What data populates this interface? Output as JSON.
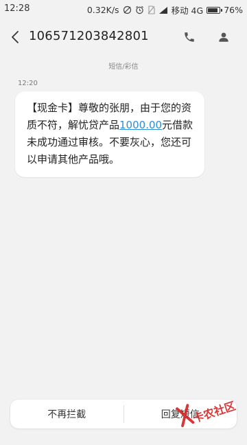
{
  "status_bar": {
    "time": "12:28",
    "speed": "0.32K/s",
    "carrier": "移动 4G",
    "battery": "76%",
    "battery_level": 0.76
  },
  "header": {
    "sender": "106571203842801"
  },
  "thread": {
    "label": "短信/彩信",
    "message_time": "12:20",
    "message": {
      "part1": "【现金卡】尊敬的张朋，由于您的资质不符，解忧贷产品",
      "amount": "1000.00",
      "part2": "元借款未成功通过审核。不要灰心，您还可以申请其他产品哦。"
    }
  },
  "bottom_bar": {
    "block_label": "不再拦截",
    "reply_label": "回复短信"
  },
  "watermark": {
    "text": "卡农社区"
  },
  "colors": {
    "link": "#2a8fd6",
    "background": "#f2f2f2",
    "watermark": "#d62828"
  }
}
